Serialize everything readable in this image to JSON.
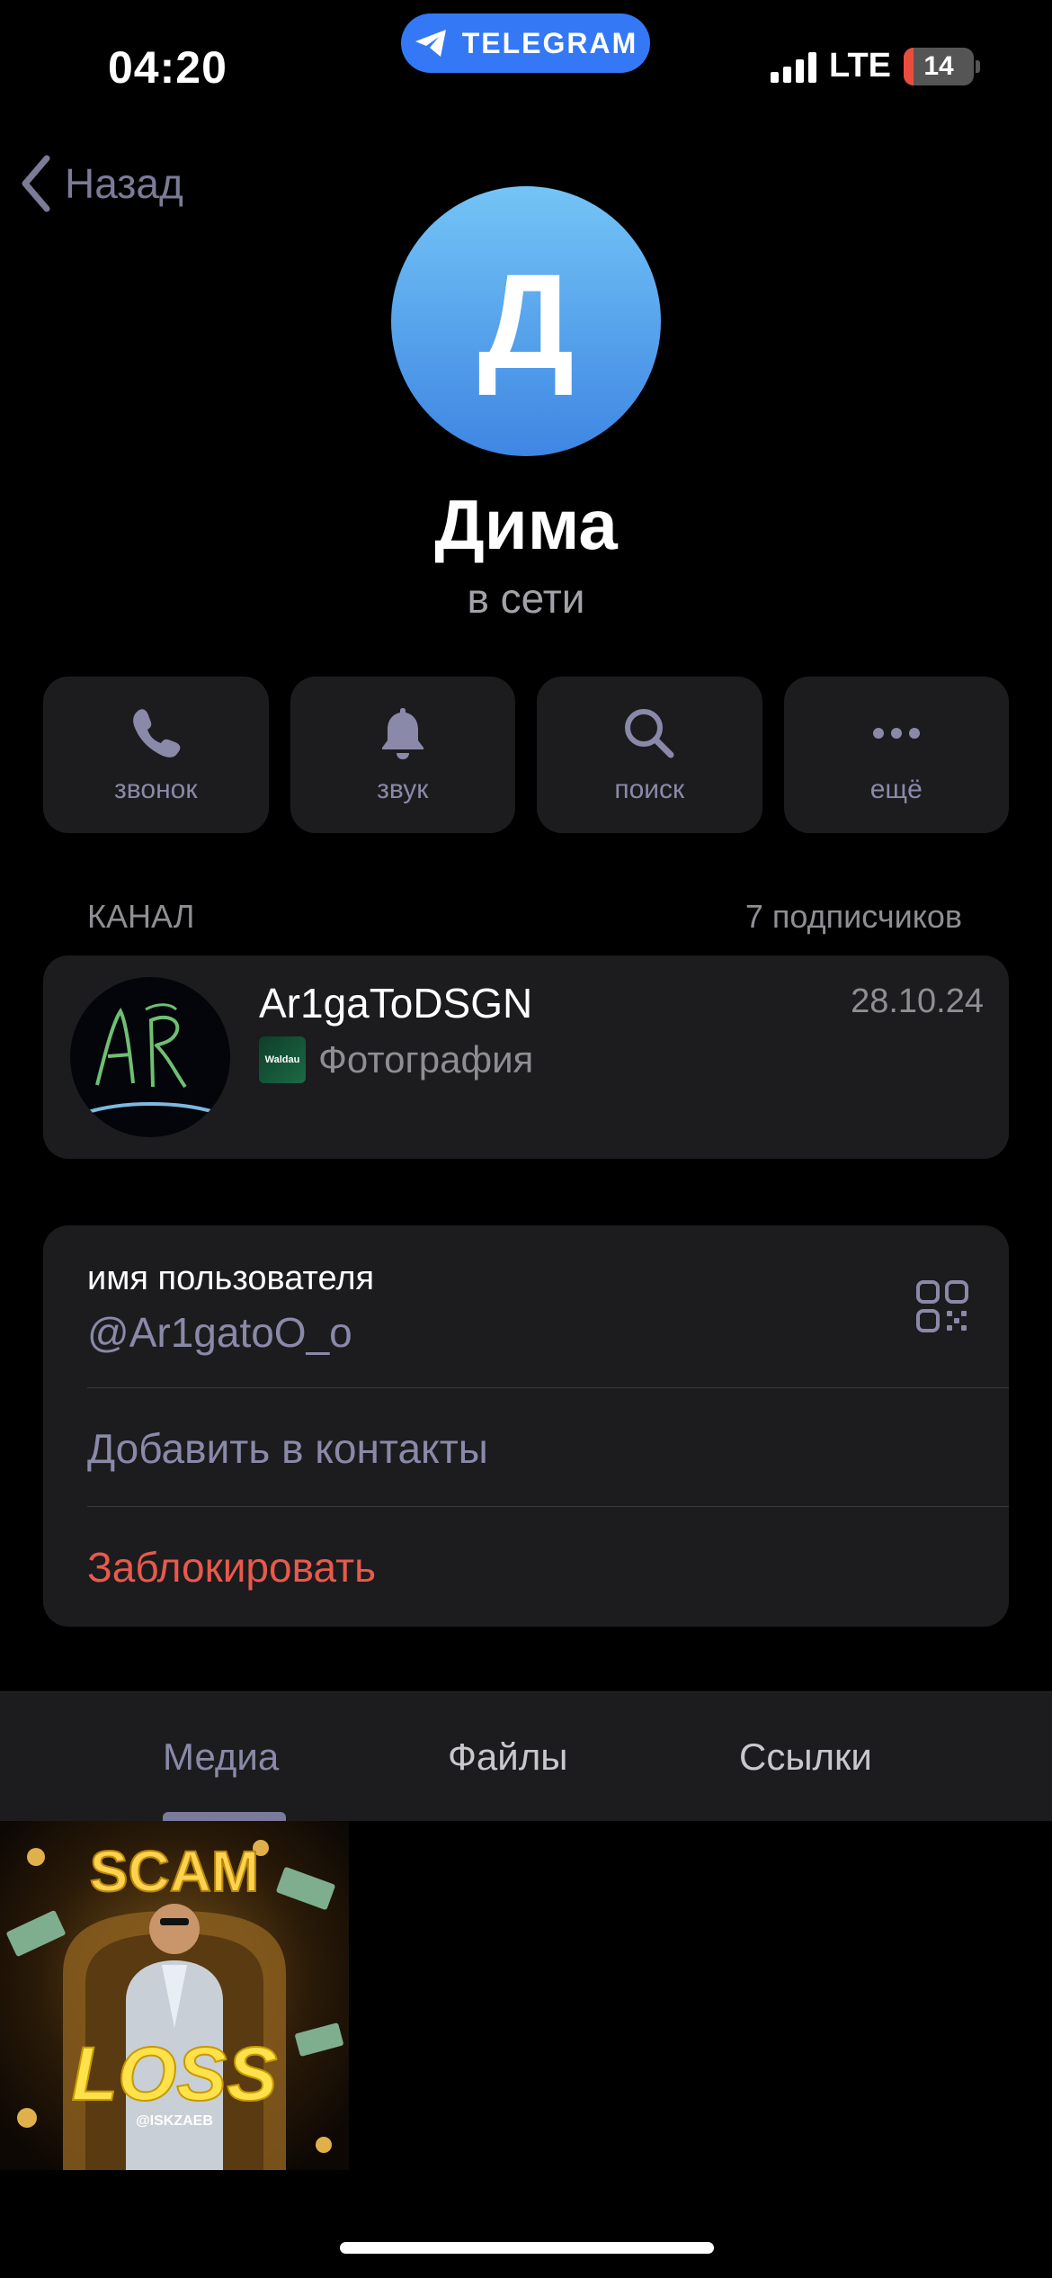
{
  "status_bar": {
    "time": "04:20",
    "app_pill": "TELEGRAM",
    "network": "LTE",
    "battery": "14",
    "battery_color": "#eb4d3d"
  },
  "nav": {
    "back_label": "Назад"
  },
  "profile": {
    "avatar_letter": "Д",
    "avatar_colors": [
      "#74c4f6",
      "#3e86e3"
    ],
    "name": "Дима",
    "status": "в сети"
  },
  "actions": [
    {
      "label": "звонок",
      "icon": "phone-icon"
    },
    {
      "label": "звук",
      "icon": "bell-icon"
    },
    {
      "label": "поиск",
      "icon": "search-icon"
    },
    {
      "label": "ещё",
      "icon": "more-icon"
    }
  ],
  "channel_section": {
    "header": "КАНАЛ",
    "subscribers": "7 подписчиков",
    "channel": {
      "avatar_text": "AR",
      "title": "Ar1gaToDSGN",
      "date": "28.10.24",
      "thumb_text": "Waldau",
      "last_message": "Фотография"
    }
  },
  "info": {
    "username_label": "имя пользователя",
    "username_value": "@Ar1gatoO_o",
    "add_contact": "Добавить в контакты",
    "block": "Заблокировать",
    "accent_color": "#8a89a9",
    "danger_color": "#e9594c"
  },
  "tabs": {
    "items": [
      "Медиа",
      "Файлы",
      "Ссылки"
    ],
    "active": 0
  },
  "media": {
    "items": [
      {
        "top_text": "SCAM",
        "bottom_text": "LOSS",
        "watermark": "@ISKZAEB"
      }
    ]
  }
}
